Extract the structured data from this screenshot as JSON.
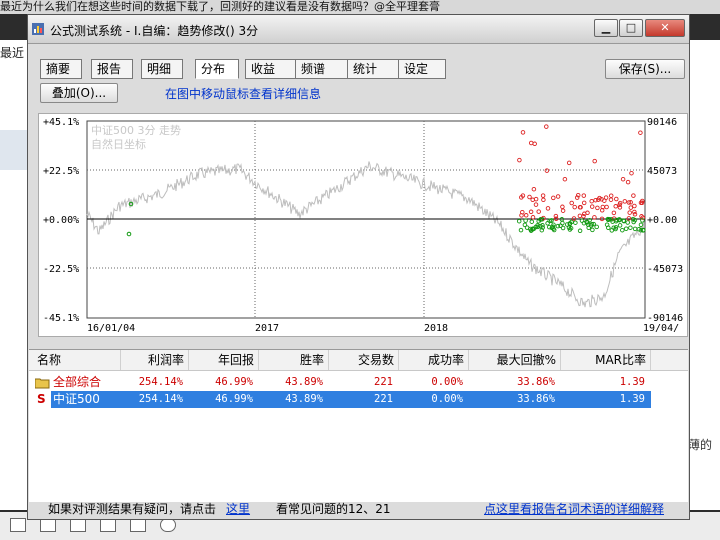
{
  "background": {
    "top_text": "最近为什么我们在想这些时间的数据下载了，回测好的建议看是没有数据吗？@全平理套膏",
    "left_text": "最近",
    "right_text": "薄的"
  },
  "window": {
    "title": "公式测试系统 - I.自编：趋势修改() 3分",
    "min_label": "▁",
    "max_label": "□",
    "close_label": "✕"
  },
  "tabs": [
    "摘要",
    "报告",
    "明细",
    "分布",
    "收益",
    "频谱",
    "统计",
    "设定"
  ],
  "active_tab": "分布",
  "buttons": {
    "save": "保存(S)...",
    "overlay": "叠加(O)..."
  },
  "hint": "在图中移动鼠标查看详细信息",
  "chart_data": {
    "type": "scatter",
    "legend": [
      "中证500 3分 走势",
      "自然日坐标"
    ],
    "y_left_ticks": [
      "+45.1%",
      "+22.5%",
      "+0.00%",
      "-22.5%",
      "-45.1%"
    ],
    "y_right_ticks": [
      "90146",
      "45073",
      "+0.00",
      "-45073",
      "-90146"
    ],
    "x_ticks": [
      "16/01/04",
      "2017",
      "2018",
      "19/04/"
    ],
    "y_range_pct": [
      -45.1,
      45.1
    ],
    "grid": true,
    "colors": {
      "index_line": "#bdbdbd",
      "profit": "#dd2222",
      "loss": "#119911",
      "zero": "#000000"
    }
  },
  "table": {
    "headers": [
      "名称",
      "利润率",
      "年回报",
      "胜率",
      "交易数",
      "成功率",
      "最大回撤%",
      "MAR比率"
    ],
    "rows": [
      {
        "icon": "folder-icon",
        "name": "全部综合",
        "values": [
          "254.14%",
          "46.99%",
          "43.89%",
          "221",
          "0.00%",
          "33.86%",
          "1.39"
        ]
      },
      {
        "icon": "S",
        "name": "中证500",
        "values": [
          "254.14%",
          "46.99%",
          "43.89%",
          "221",
          "0.00%",
          "33.86%",
          "1.39"
        ]
      }
    ]
  },
  "footer": {
    "question_text": "如果对评测结果有疑问，请点击",
    "here_link": "这里",
    "faq_text": "看常见问题的12、21",
    "glossary_link": "点这里看报告名词术语的详细解释"
  }
}
